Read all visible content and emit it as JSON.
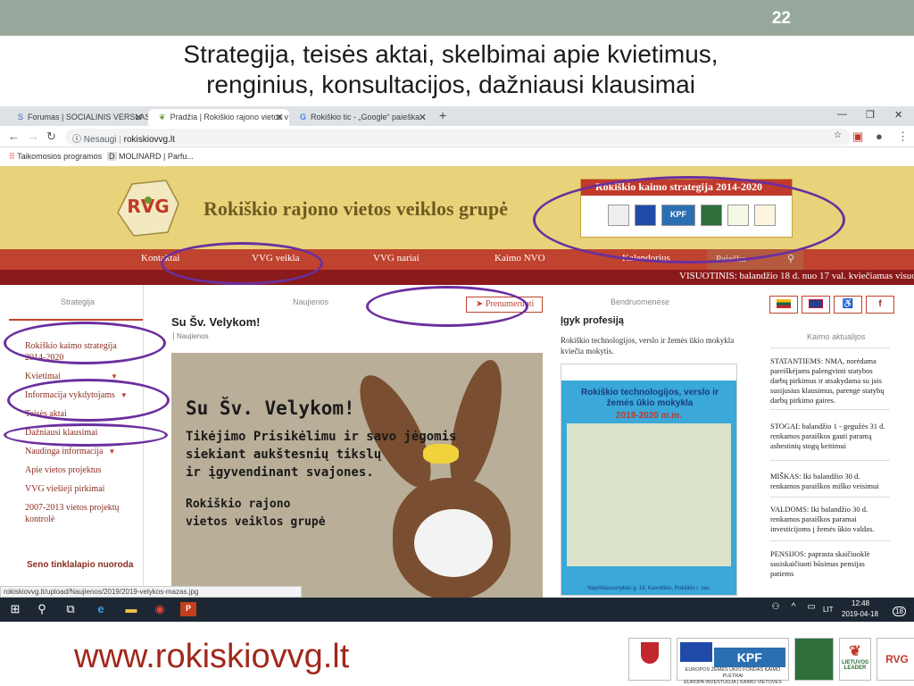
{
  "slide": {
    "page_number": "22",
    "title_line1": "Strategija, teisės aktai, skelbimai apie kvietimus,",
    "title_line2": "renginius, konsultacijos, dažniausi klausimai",
    "footer_url": "www.rokiskiovvg.lt",
    "footer_logo_texts": [
      "EUROPOS ŽEMĖS ŪKIO FONDAS KAIMO PLĖTRAI",
      "EUROPA INVESTUOJA Į KAIMO VIETOVES",
      "KPF",
      "LIETUVOS LEADER"
    ]
  },
  "browser": {
    "tabs": [
      {
        "label": "Forumas | SOCIALINIS VERSLAS",
        "icon": "S"
      },
      {
        "label": "Pradžia | Rokiškio rajono vietos v",
        "icon": "leaf"
      },
      {
        "label": "Rokiškio tic - „Google“ paieška",
        "icon": "G"
      }
    ],
    "security_label": "Nesaugi",
    "url": "rokiskiovvg.lt",
    "bookmarks": [
      "Taikomosios programos",
      "MOLINARD | Parfu..."
    ],
    "status_url": "rokiskiovvg.lt/upload/Naujienos/2019/2019-velykos-mazas.jpg"
  },
  "site": {
    "title": "Rokiškio rajono vietos veiklos grupė",
    "strategy_heading": "Rokiškio kaimo strategija 2014-2020",
    "nav": [
      "Kontaktai",
      "VVG veikla",
      "VVG nariai",
      "Kaimo NVO",
      "Kalendorius"
    ],
    "search_placeholder": "Paieška",
    "ticker": "VISUOTINIS: balandžio 18 d. nuo 17 val. kviečiamas visuo",
    "sidebar": {
      "label": "Strategija",
      "items": [
        "Rokiškio kaimo strategija 2014-2020",
        "Kvietimai",
        "Informacija vykdytojams",
        "Teisės aktai",
        "Dažniausi klausimai",
        "Naudinga informacija",
        "Apie vietos projektus",
        "VVG viešieji pirkimai",
        "2007-2013 vietos projektų kontrolė"
      ],
      "old_site_heading": "Seno tinklalapio nuoroda"
    },
    "news": {
      "label": "Naujienos",
      "subscribe_label": "Prenumeruoti",
      "headline": "Su Šv. Velykom!",
      "meta": "Naujienos",
      "image_line1": "Su Šv. Velykom!",
      "image_line2": "Tikėjimo Prisikėlimu ir savo jėgomis",
      "image_line3": "siekiant aukštesnių tikslų",
      "image_line4": "ir įgyvendinant svajones.",
      "image_line5": "Rokiškio rajono",
      "image_line6": "vietos veiklos grupė"
    },
    "community": {
      "label": "Bendruomenėse",
      "title": "Įgyk profesiją",
      "text": "Rokiškio technologijos, verslo ir žemės ūkio mokykla kviečia mokytis.",
      "poster_title": "Rokiškio technologijos, verslo ir žemės ūkio mokykla",
      "poster_year": "2019-2020 m.m.",
      "poster_footer": "Nepriklausomybės g. 18, Kavoliškis, Rokiškio r. sav."
    },
    "right": {
      "flags": [
        "LT",
        "EN",
        "♿",
        "f"
      ],
      "label": "Kaimo aktualijos",
      "items": [
        "STATANTIEMS: NMA, norėdama pareiškėjams palengvinti statybos darbų pirkimus ir atsakydama su jais susijusius klausimus, parengė statybų darbų pirkimo gaires.",
        "STOGAI: balandžio 1 - gegužės 31 d. renkamos paraiškos gauti paramą asbestinių stogų keitimui",
        "MIŠKAS: Iki balandžio 30 d. renkamos paraiškos miško veisimui",
        "VALDOMS: Iki balandžio 30 d. renkamos paraiškos paramai investicijoms į žemės ūkio valdas.",
        "PENSIJOS: paprasta skaičiuoklė susiskaičiuoti būsimas pensijas patiems"
      ]
    }
  },
  "taskbar": {
    "lang": "LIT",
    "time": "12:48",
    "date": "2019-04-18",
    "notifications": "18"
  },
  "colors": {
    "accent": "#c0432f",
    "header": "#e9d37a",
    "highlight_ellipse": "#6b2f9e"
  }
}
